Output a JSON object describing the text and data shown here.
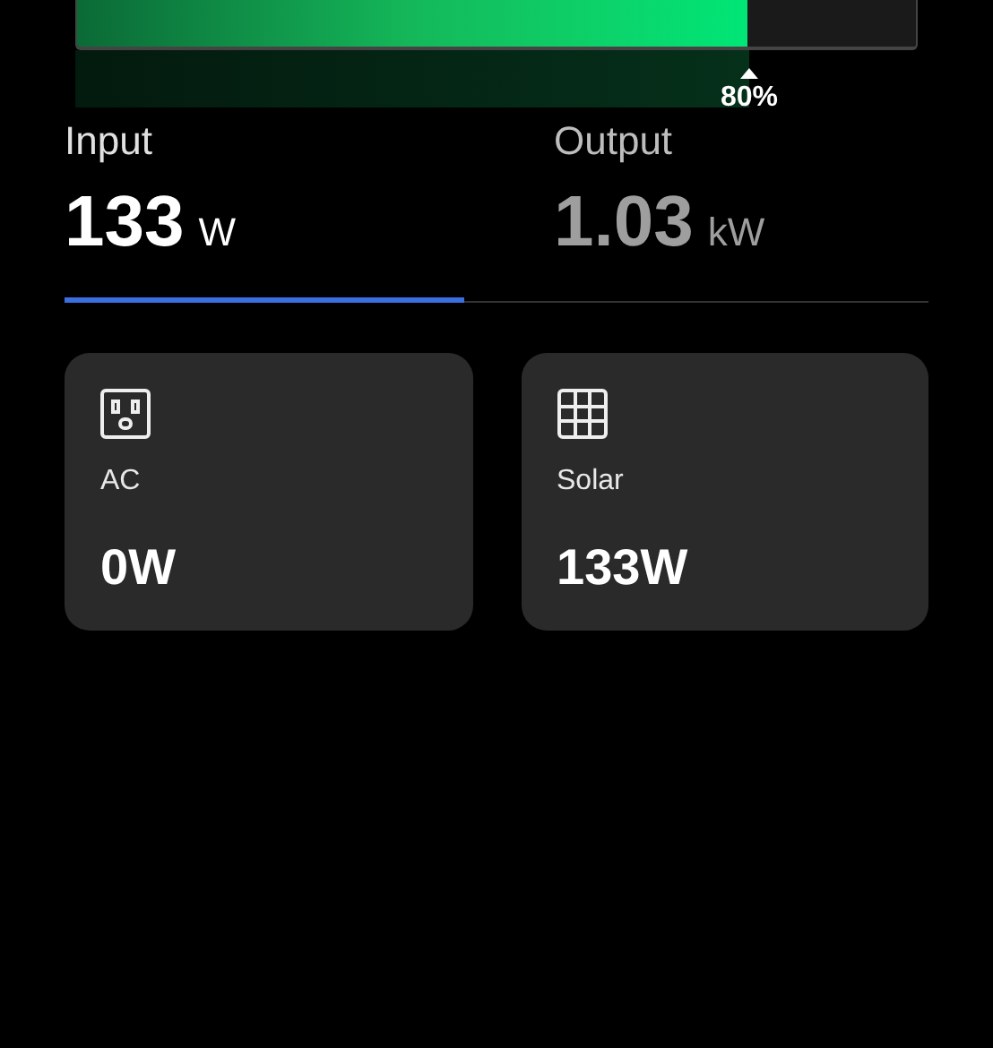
{
  "battery": {
    "level": 0.8,
    "reading": "80%"
  },
  "tabs": [
    {
      "label": "Input",
      "value": "133",
      "unit": "W",
      "selected": true
    },
    {
      "label": "Output",
      "value": "1.03",
      "unit": "kW",
      "selected": false
    }
  ],
  "sources": [
    {
      "kind": "ac",
      "label": "AC",
      "value": "0W"
    },
    {
      "kind": "solar",
      "label": "Solar",
      "value": "133W"
    }
  ]
}
